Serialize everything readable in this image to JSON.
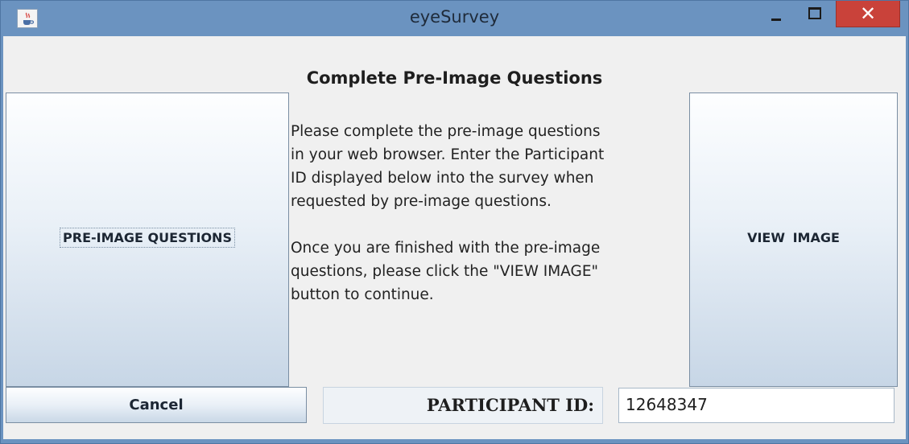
{
  "window": {
    "title": "eyeSurvey",
    "icon": "java-cup-icon",
    "controls": {
      "minimize": "minimize-icon",
      "maximize": "maximize-icon",
      "close": "✕"
    }
  },
  "heading": "Complete Pre-Image Questions",
  "buttons": {
    "pre_image": "PRE-IMAGE QUESTIONS",
    "view_image": "VIEW  IMAGE",
    "cancel": "Cancel"
  },
  "message": {
    "paragraph1": "Please complete the pre-image questions\nin your web browser.  Enter the Participant\nID displayed below into the survey when\nrequested by pre-image questions.",
    "paragraph2": "Once you are finished with the pre-image\nquestions, please click the \"VIEW IMAGE\"\nbutton to continue."
  },
  "participant": {
    "label": "PARTICIPANT ID:",
    "id": "12648347"
  },
  "colors": {
    "titlebar": "#6b93c0",
    "close_button": "#c9423a",
    "panel": "#f0f0f0"
  }
}
